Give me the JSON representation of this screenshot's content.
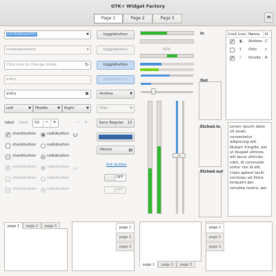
{
  "window": {
    "title": "GTK+ Widget Factory",
    "menu_icon": "hamburger-menu-icon"
  },
  "stack_switcher": [
    "Page 1",
    "Page 2",
    "Page 3"
  ],
  "col1": {
    "combo_entry_value": "comboboxentry",
    "combo_entry_disabled_value": "comboboxentry",
    "mode_entry_placeholder": "Click icon to change mode",
    "mode_icon": "refresh-icon",
    "disabled_entry_value": "entry",
    "clear_entry_value": "entry",
    "clear_icon": "clear-icon",
    "linked_buttons": [
      "Left",
      "Middle",
      "Right"
    ],
    "label1": "label",
    "label2": "label",
    "spin_value": "50",
    "spin_minus": "−",
    "spin_plus": "+",
    "check_rows": [
      {
        "check": "checkbutton",
        "radio": "radiobutton"
      },
      {
        "check": "checkbutton",
        "radio": "radiobutton"
      },
      {
        "check": "checkbutton",
        "radio": "radiobutton"
      },
      {
        "check": "checkbutton",
        "radio": "radiobutton"
      },
      {
        "check": "checkbutton",
        "radio": "radiobutton"
      },
      {
        "check": "checkbutton",
        "radio": "radiobutton"
      }
    ]
  },
  "col2": {
    "toggle_buttons": [
      "togglebutton",
      "togglebutton",
      "togglebutton",
      "togglebutton"
    ],
    "combo_person": "Andrea",
    "combo_person_disabled": "Otto",
    "font_button": "Sans Regular",
    "font_size": "12",
    "color_button": "#3465a4",
    "file_chooser": "(None)",
    "file_icon": "file-icon",
    "link_button": "link button",
    "switch_off_label": "OFF",
    "switch_off_label_disabled": "OFF"
  },
  "col3": {
    "progress_values": [
      0.5,
      0.0,
      0.5
    ],
    "progress_label": "50%",
    "level_values": [
      0.4,
      0.35
    ],
    "slider_values": [
      0.55,
      0.2,
      0.2
    ],
    "vertical_levels": [
      0.4,
      0.6,
      0.5,
      0.0
    ],
    "accent": "#4a90d9",
    "progress_color": "#2db82d"
  },
  "frames": {
    "in": "In",
    "out": "Out",
    "etched_in": "Etched in",
    "etched_out": "Etched out"
  },
  "tree": {
    "columns": [
      "Cool",
      "Icon",
      "Name",
      "N"
    ],
    "rows": [
      {
        "cool": "✔",
        "icon": "moon-icon",
        "icon_glyph": "◐",
        "name": "Andrea",
        "n": "C"
      },
      {
        "cool": "",
        "icon": "warning-icon",
        "icon_glyph": "!",
        "name": "Otto",
        "n": "c"
      },
      {
        "cool": "✔",
        "icon": "night-icon",
        "icon_glyph": "☾",
        "name": "Orville",
        "n": "R"
      }
    ]
  },
  "text_view": "Lorem ipsum dolor sit amet, consectetur adipiscing elit. Nullam fringilla, est ut feugiat ultrices, elit lacus ultricies nibh, id commodo tortor nisi id elit. Class aptent taciti sociosqu ad litora torquent per conubia nostra, per",
  "notebooks": [
    {
      "tabs": [
        "page 1",
        "page 2",
        "page 3"
      ]
    },
    {
      "tabs": [
        "page 1",
        "page 2",
        "page 3"
      ]
    },
    {
      "tabs": [
        "page 1",
        "page 2",
        "page 3"
      ]
    },
    {
      "tabs": [
        "page 1",
        "page 2",
        "page 3"
      ]
    }
  ]
}
